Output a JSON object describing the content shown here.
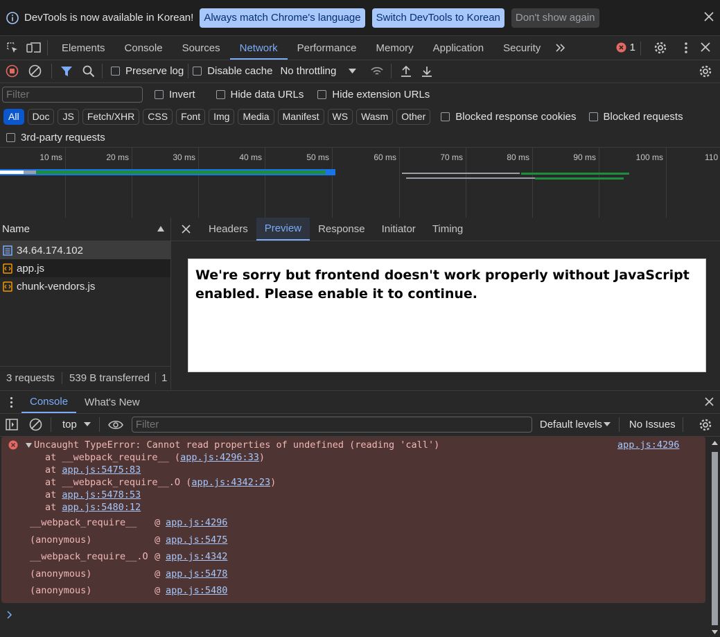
{
  "infobar": {
    "message": "DevTools is now available in Korean!",
    "btn_match": "Always match Chrome's language",
    "btn_switch": "Switch DevTools to Korean",
    "btn_dismiss": "Don't show again"
  },
  "main_tabs": [
    "Elements",
    "Console",
    "Sources",
    "Network",
    "Performance",
    "Memory",
    "Application",
    "Security"
  ],
  "active_tab": "Network",
  "error_count": "1",
  "network_toolbar": {
    "preserve_log": "Preserve log",
    "disable_cache": "Disable cache",
    "throttling": "No throttling"
  },
  "filter": {
    "placeholder": "Filter",
    "invert": "Invert",
    "hide_data_urls": "Hide data URLs",
    "hide_extension_urls": "Hide extension URLs"
  },
  "type_filters": [
    "All",
    "Doc",
    "JS",
    "Fetch/XHR",
    "CSS",
    "Font",
    "Img",
    "Media",
    "Manifest",
    "WS",
    "Wasm",
    "Other"
  ],
  "blocked_cookies": "Blocked response cookies",
  "blocked_requests": "Blocked requests",
  "third_party": "3rd-party requests",
  "timeline_ticks": [
    "10 ms",
    "20 ms",
    "30 ms",
    "40 ms",
    "50 ms",
    "60 ms",
    "70 ms",
    "80 ms",
    "90 ms",
    "100 ms",
    "110"
  ],
  "requests": {
    "header": "Name",
    "items": [
      "34.64.174.102",
      "app.js",
      "chunk-vendors.js"
    ],
    "status_requests": "3 requests",
    "status_transferred": "539 B transferred",
    "status_more": "1"
  },
  "detail_tabs": [
    "Headers",
    "Preview",
    "Response",
    "Initiator",
    "Timing"
  ],
  "active_detail_tab": "Preview",
  "preview_text": "We're sorry but frontend doesn't work properly without JavaScript enabled. Please enable it to continue.",
  "console_tabs": [
    "Console",
    "What's New"
  ],
  "console_toolbar": {
    "context": "top",
    "filter_placeholder": "Filter",
    "levels": "Default levels",
    "issues": "No Issues"
  },
  "error": {
    "message": "Uncaught TypeError: Cannot read properties of undefined (reading 'call')",
    "source": "app.js:4296",
    "stack": [
      {
        "prefix": "at __webpack_require__ (",
        "link": "app.js:4296:33",
        "suffix": ")"
      },
      {
        "prefix": "at ",
        "link": "app.js:5475:83",
        "suffix": ""
      },
      {
        "prefix": "at __webpack_require__.O (",
        "link": "app.js:4342:23",
        "suffix": ")"
      },
      {
        "prefix": "at ",
        "link": "app.js:5478:53",
        "suffix": ""
      },
      {
        "prefix": "at ",
        "link": "app.js:5480:12",
        "suffix": ""
      }
    ],
    "frames": [
      {
        "fn": "__webpack_require__",
        "link": "app.js:4296"
      },
      {
        "fn": "(anonymous)",
        "link": "app.js:5475"
      },
      {
        "fn": "__webpack_require__.O",
        "link": "app.js:4342"
      },
      {
        "fn": "(anonymous)",
        "link": "app.js:5478"
      },
      {
        "fn": "(anonymous)",
        "link": "app.js:5480"
      }
    ]
  },
  "colors": {
    "accent": "#7cacf8",
    "error_bg": "#4e3534",
    "error_icon": "#e46962",
    "link": "#a8c7fa"
  }
}
